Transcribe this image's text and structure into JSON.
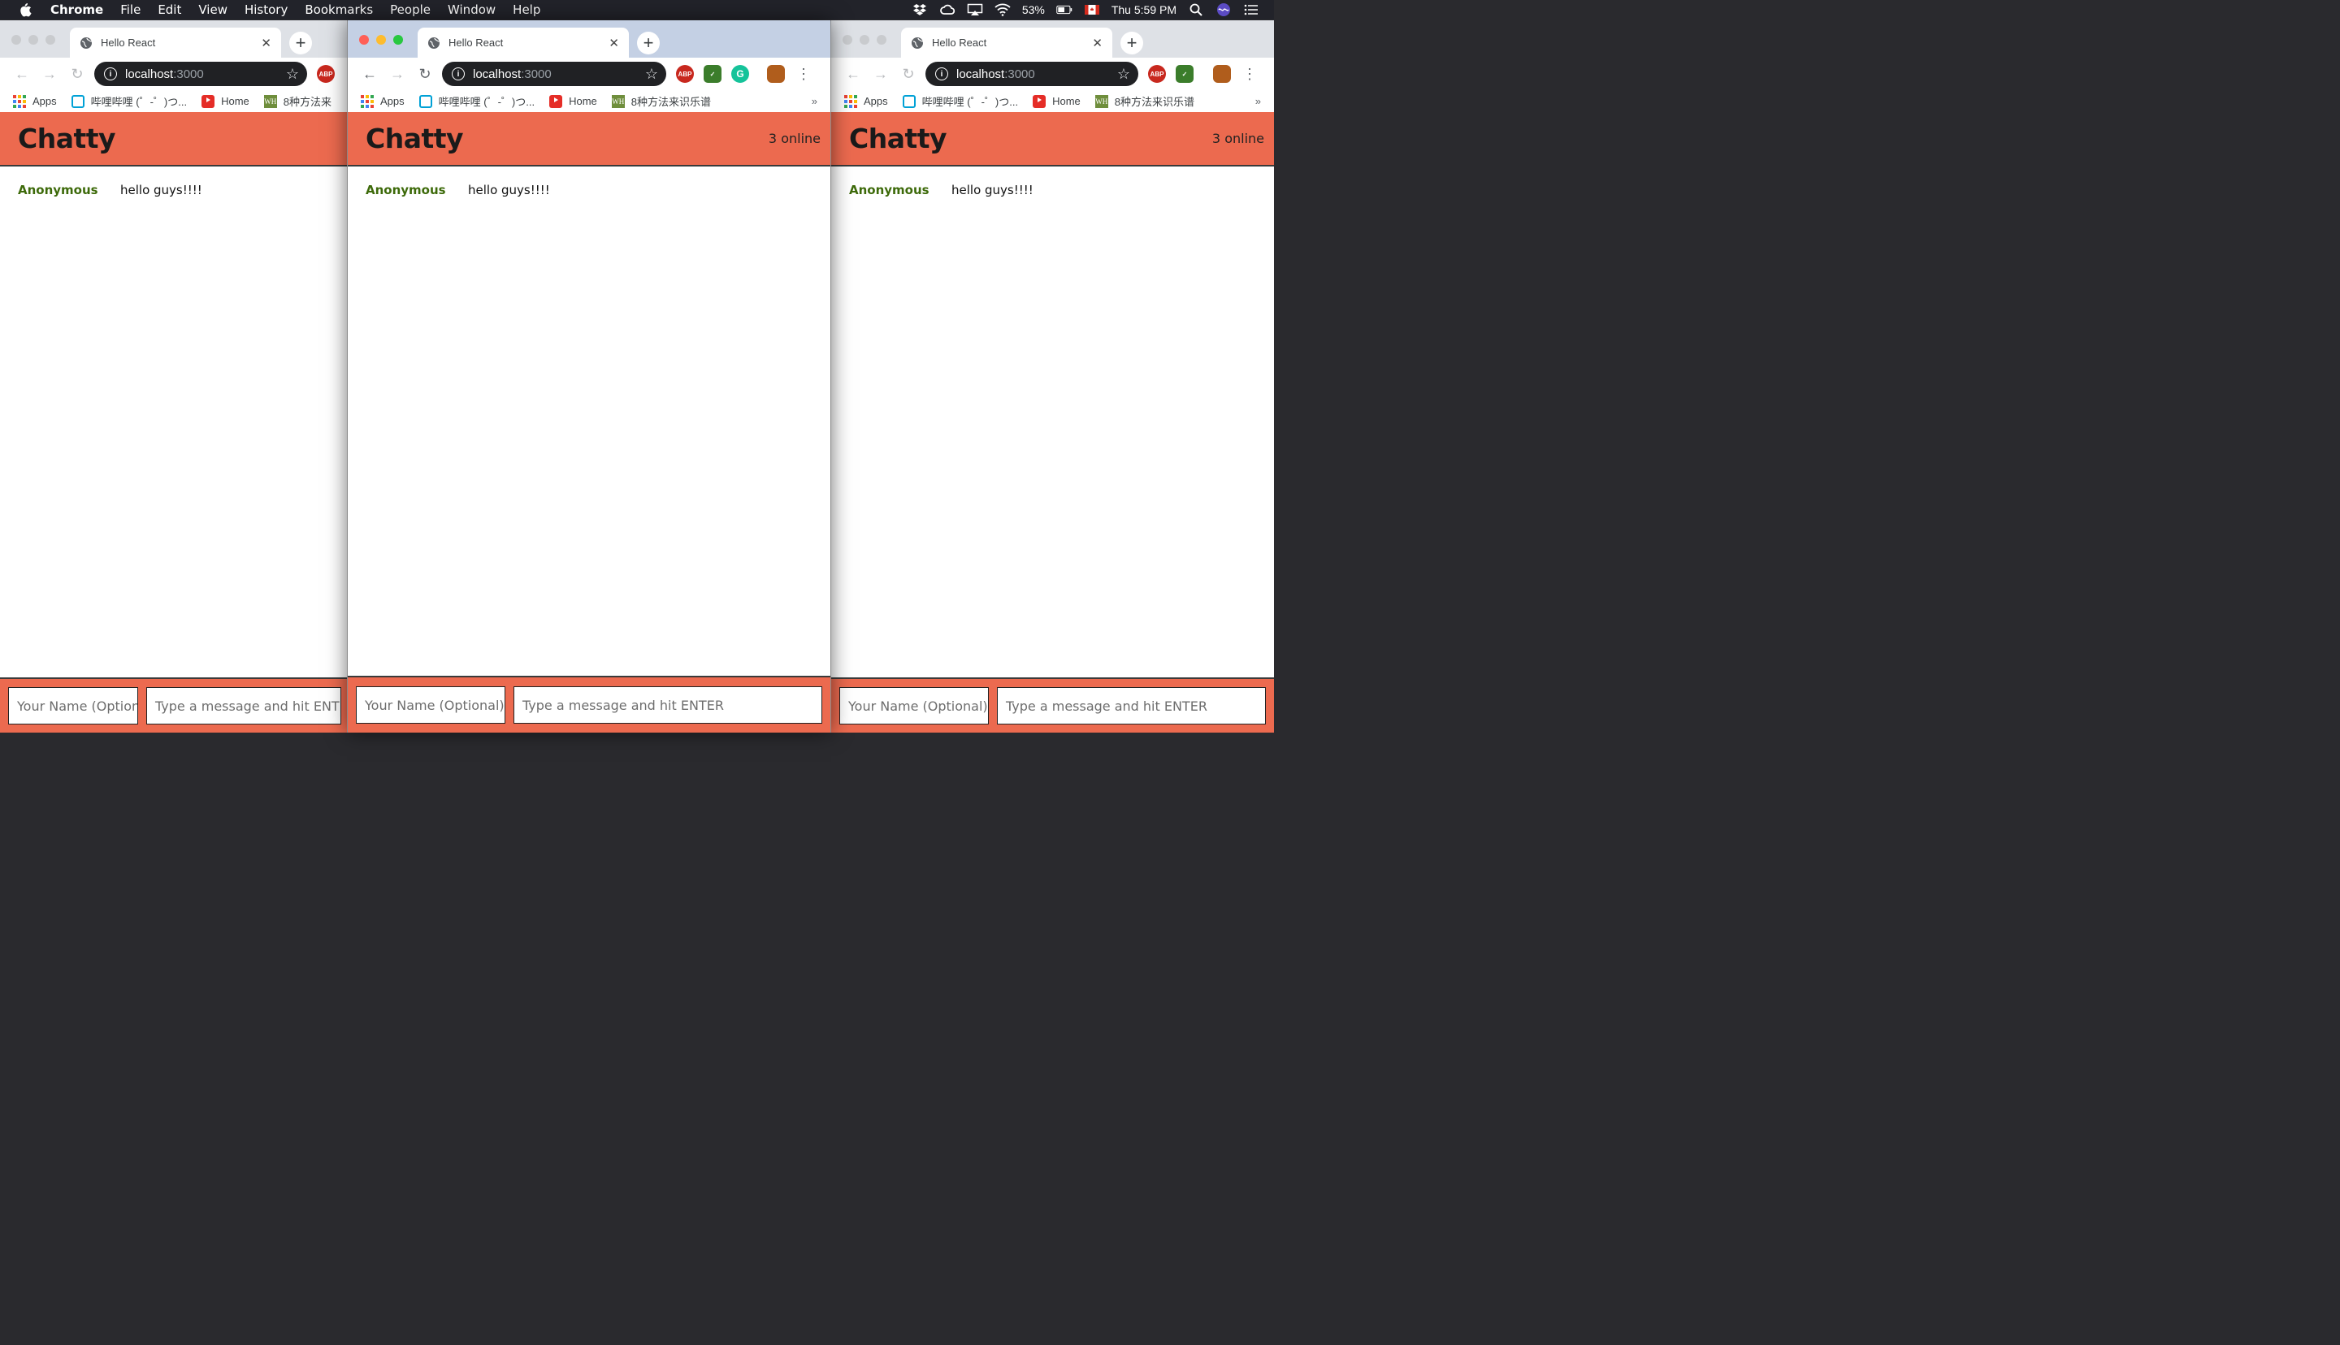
{
  "menubar": {
    "app": "Chrome",
    "items": [
      "File",
      "Edit",
      "View",
      "History",
      "Bookmarks",
      "People",
      "Window",
      "Help"
    ],
    "battery": "53%",
    "clock": "Thu 5:59 PM"
  },
  "browser": {
    "tab_title": "Hello React",
    "url_host": "localhost",
    "url_port": ":3000",
    "bookmarks": [
      "Apps",
      "哔哩哔哩 (゜-゜)つ...",
      "Home",
      "8种方法来识乐谱"
    ],
    "bookmarks_truncated": "8种方法来",
    "ext_abp": "ABP",
    "ext_wh": "WH",
    "more": "»"
  },
  "app": {
    "title": "Chatty",
    "online_count": "3 online",
    "messages": [
      {
        "username": "Anonymous",
        "content": "hello guys!!!!"
      }
    ],
    "name_placeholder": "Your Name (Optional)",
    "message_placeholder": "Type a message and hit ENTER"
  },
  "colors": {
    "header": "#ec6a4f",
    "username": "#3d6a0a"
  }
}
